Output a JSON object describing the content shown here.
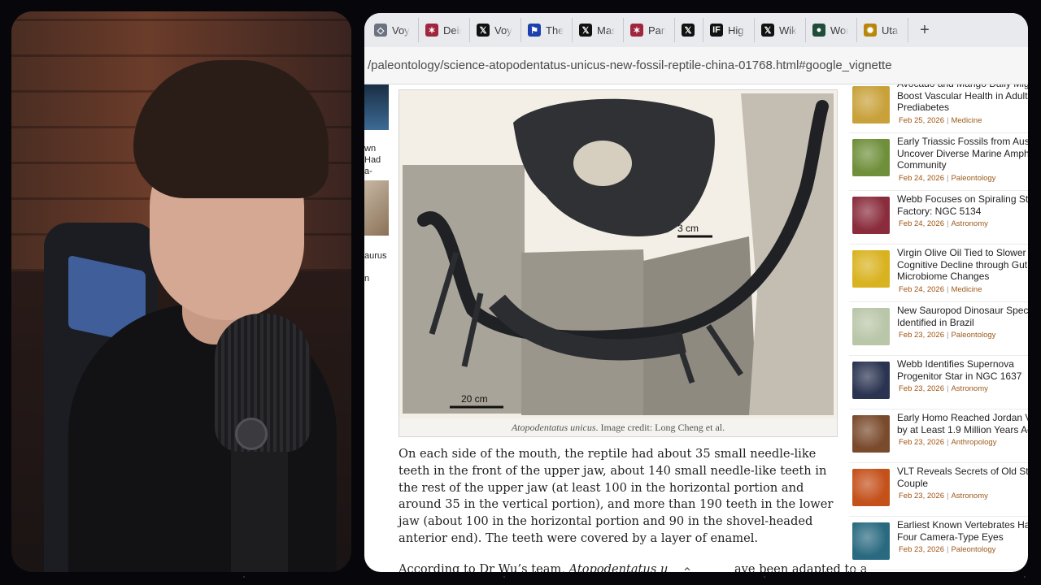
{
  "tabs": [
    {
      "label": "Voy",
      "icon": "generic-site-icon",
      "color": "#6b7280"
    },
    {
      "label": "Deir",
      "icon": "star-logo-icon",
      "color": "#a0263e"
    },
    {
      "label": "Voy",
      "icon": "x-logo-icon",
      "color": "#111111"
    },
    {
      "label": "The",
      "icon": "flag-icon",
      "color": "#1e40af"
    },
    {
      "label": "Mas",
      "icon": "x-logo-icon",
      "color": "#111111"
    },
    {
      "label": "Pan",
      "icon": "star-logo-icon",
      "color": "#a0263e"
    },
    {
      "label": "",
      "icon": "x-logo-icon",
      "color": "#111111"
    },
    {
      "label": "Hig",
      "icon": "ifls-logo-icon",
      "color": "#111111"
    },
    {
      "label": "Wik",
      "icon": "x-logo-icon",
      "color": "#111111"
    },
    {
      "label": "Wor",
      "icon": "circle-logo-icon",
      "color": "#1f4d3a"
    },
    {
      "label": "Uta",
      "icon": "sun-logo-icon",
      "color": "#b8860b"
    }
  ],
  "url": "/paleontology/science-atopodentatus-unicus-new-fossil-reptile-china-01768.html#google_vignette",
  "left_sidebar": {
    "item1_lines": [
      "wn",
      "Had",
      "a-"
    ],
    "item2_lines": [
      "aurus",
      "n"
    ]
  },
  "figure": {
    "scale_top": "3 cm",
    "scale_bottom": "20 cm",
    "caption_italic": "Atopodentatus unicus",
    "caption_rest": ". Image credit: Long Cheng et al."
  },
  "article": {
    "paragraph1": "On each side of the mouth, the reptile had about 35 small needle-like teeth in the front of the upper jaw, about 140 small needle-like teeth in the rest of the upper jaw (at least 100 in the horizontal portion and around 35 in the vertical portion), and more than 190 teeth in the lower jaw (about 100 in the horizontal portion and 90 in the shovel-headed anterior end). The teeth were covered by a layer of enamel.",
    "paragraph2_start": "According to Dr Wu’s team, ",
    "paragraph2_italic": "Atopodentatus unicu",
    "paragraph2_end": "ave been adapted to a"
  },
  "sidebar": [
    {
      "title_lines": [
        "Avocado and Mango Daily Might",
        "Boost Vascular Health in Adults",
        "Prediabetes"
      ],
      "date": "Feb 25, 2026",
      "category": "Medicine",
      "thumb": "#c8a13a"
    },
    {
      "title_lines": [
        "Early Triassic Fossils from Austr",
        "Uncover Diverse Marine Amphi",
        "Community"
      ],
      "date": "Feb 24, 2026",
      "category": "Paleontology",
      "thumb": "#6f8f3a"
    },
    {
      "title_lines": [
        "Webb Focuses on Spiraling Star",
        "Factory: NGC 5134"
      ],
      "date": "Feb 24, 2026",
      "category": "Astronomy",
      "thumb": "#8a2c3c"
    },
    {
      "title_lines": [
        "Virgin Olive Oil Tied to Slower",
        "Cognitive Decline through Gut",
        "Microbiome Changes"
      ],
      "date": "Feb 24, 2026",
      "category": "Medicine",
      "thumb": "#d9b21f"
    },
    {
      "title_lines": [
        "New Sauropod Dinosaur Specie",
        "Identified in Brazil"
      ],
      "date": "Feb 23, 2026",
      "category": "Paleontology",
      "thumb": "#b9c6a8"
    },
    {
      "title_lines": [
        "Webb Identifies Supernova",
        "Progenitor Star in NGC 1637"
      ],
      "date": "Feb 23, 2026",
      "category": "Astronomy",
      "thumb": "#2a3350"
    },
    {
      "title_lines": [
        "Early Homo Reached Jordan Val",
        "by at Least 1.9 Million Years Ag"
      ],
      "date": "Feb 23, 2026",
      "category": "Anthropology",
      "thumb": "#7a4a2c"
    },
    {
      "title_lines": [
        "VLT Reveals Secrets of Old Stell",
        "Couple"
      ],
      "date": "Feb 23, 2026",
      "category": "Astronomy",
      "thumb": "#c4501a"
    },
    {
      "title_lines": [
        "Earliest Known Vertebrates Ha",
        "Four Camera-Type Eyes"
      ],
      "date": "Feb 23, 2026",
      "category": "Paleontology",
      "thumb": "#2a6a80"
    }
  ]
}
